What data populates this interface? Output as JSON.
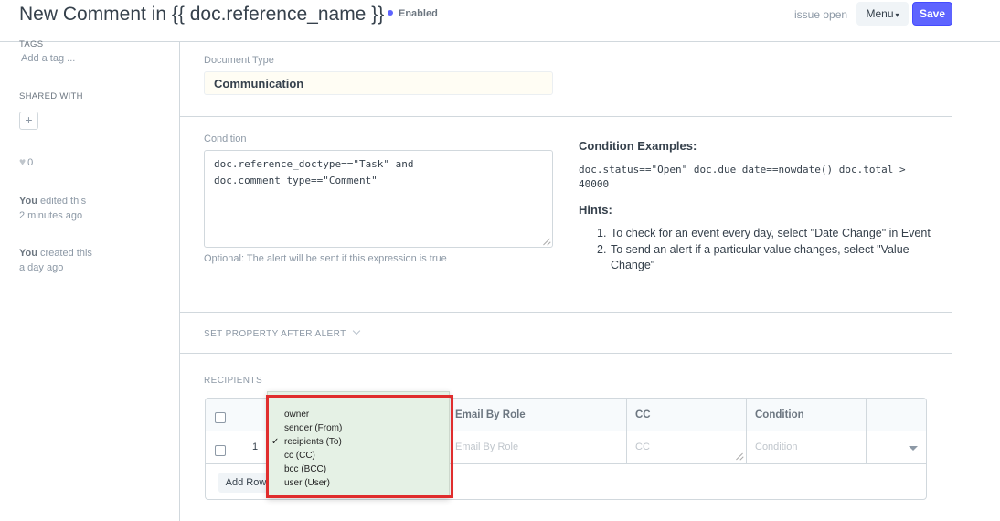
{
  "header": {
    "title": "New Comment in {{ doc.reference_name }}",
    "indicator": "Enabled",
    "status_text": "issue open",
    "menu_label": "Menu",
    "save_label": "Save"
  },
  "sidebar": {
    "tags_label": "TAGS",
    "add_tag": "Add a tag ...",
    "shared_label": "SHARED WITH",
    "add_share": "+",
    "likes": "0",
    "timeline": [
      {
        "actor": "You",
        "action": "edited this",
        "when": "2 minutes ago"
      },
      {
        "actor": "You",
        "action": "created this",
        "when": "a day ago"
      }
    ]
  },
  "form": {
    "document_type_label": "Document Type",
    "document_type_value": "Communication",
    "condition_label": "Condition",
    "condition_value": "doc.reference_doctype==\"Task\" and\ndoc.comment_type==\"Comment\"",
    "condition_help": "Optional: The alert will be sent if this expression is true",
    "examples_title": "Condition Examples:",
    "examples_code": "doc.status==\"Open\" doc.due_date==nowdate() doc.total > 40000",
    "hints_title": "Hints:",
    "hints": [
      "To check for an event every day, select \"Date Change\" in Event",
      "To send an alert if a particular value changes, select \"Value Change\""
    ],
    "set_property_section": "SET PROPERTY AFTER ALERT",
    "recipients_section": "RECIPIENTS"
  },
  "grid": {
    "columns": [
      "Email By Role",
      "CC",
      "Condition"
    ],
    "row_index": "1",
    "placeholders": {
      "email_by_role": "Email By Role",
      "cc": "CC",
      "condition": "Condition"
    },
    "add_row_label": "Add Row"
  },
  "popup": {
    "options": [
      {
        "label": "owner",
        "checked": false
      },
      {
        "label": "sender (From)",
        "checked": false
      },
      {
        "label": "recipients (To)",
        "checked": true
      },
      {
        "label": "cc (CC)",
        "checked": false
      },
      {
        "label": "bcc (BCC)",
        "checked": false
      },
      {
        "label": "user (User)",
        "checked": false
      }
    ]
  },
  "colors": {
    "primary": "#5e64ff",
    "highlight_border": "#e02d2d",
    "popup_bg": "#e5f1e5"
  }
}
